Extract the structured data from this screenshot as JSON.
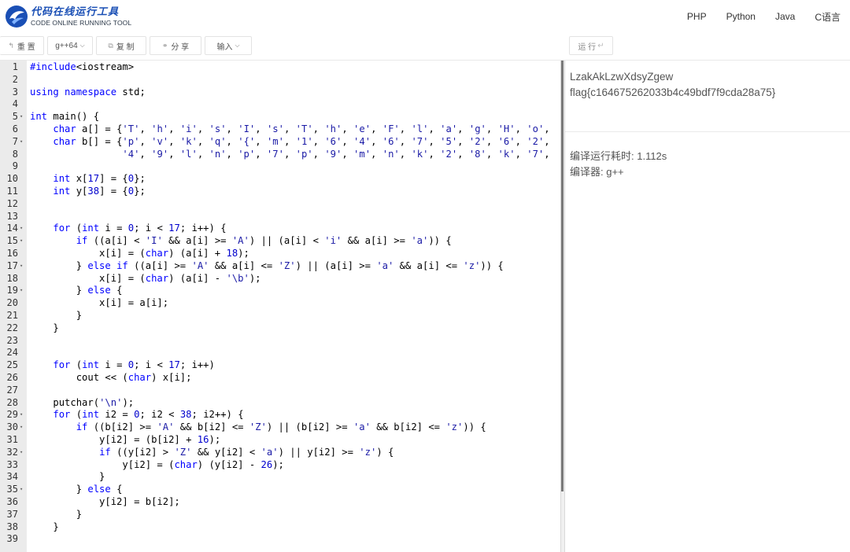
{
  "header": {
    "logo_title": "代码在线运行工具",
    "logo_subtitle": "CODE ONLINE RUNNING TOOL",
    "nav": [
      "PHP",
      "Python",
      "Java",
      "C语言"
    ]
  },
  "toolbar": {
    "reset_label": "重 置",
    "compiler_label": "g++64",
    "copy_label": "复 制",
    "share_label": "分 享",
    "input_label": "输入",
    "run_label": "运 行"
  },
  "editor": {
    "lines": [
      "#include<iostream>",
      "",
      "using namespace std;",
      "",
      "int main() {",
      "    char a[] = {'T', 'h', 'i', 's', 'I', 's', 'T', 'h', 'e', 'F', 'l', 'a', 'g', 'H', 'o',",
      "    char b[] = {'p', 'v', 'k', 'q', '{', 'm', '1', '6', '4', '6', '7', '5', '2', '6', '2',",
      "                '4', '9', 'l', 'n', 'p', '7', 'p', '9', 'm', 'n', 'k', '2', '8', 'k', '7',",
      "",
      "    int x[17] = {0};",
      "    int y[38] = {0};",
      "",
      "",
      "    for (int i = 0; i < 17; i++) {",
      "        if ((a[i] < 'I' && a[i] >= 'A') || (a[i] < 'i' && a[i] >= 'a')) {",
      "            x[i] = (char) (a[i] + 18);",
      "        } else if ((a[i] >= 'A' && a[i] <= 'Z') || (a[i] >= 'a' && a[i] <= 'z')) {",
      "            x[i] = (char) (a[i] - '\\b');",
      "        } else {",
      "            x[i] = a[i];",
      "        }",
      "    }",
      "",
      "",
      "    for (int i = 0; i < 17; i++)",
      "        cout << (char) x[i];",
      "",
      "    putchar('\\n');",
      "    for (int i2 = 0; i2 < 38; i2++) {",
      "        if ((b[i2] >= 'A' && b[i2] <= 'Z') || (b[i2] >= 'a' && b[i2] <= 'z')) {",
      "            y[i2] = (b[i2] + 16);",
      "            if ((y[i2] > 'Z' && y[i2] < 'a') || y[i2] >= 'z') {",
      "                y[i2] = (char) (y[i2] - 26);",
      "            }",
      "        } else {",
      "            y[i2] = b[i2];",
      "        }",
      "    }",
      ""
    ],
    "fold_lines": [
      5,
      7,
      14,
      15,
      17,
      19,
      29,
      30,
      32,
      35
    ]
  },
  "output": {
    "line1": "LzakAkLzwXdsyZgew",
    "line2": "flag{c164675262033b4c49bdf7f9cda28a75}",
    "time_label": "编译运行耗时: 1.112s",
    "compiler_info": "编译器: g++"
  },
  "colors": {
    "keyword": "#0000ff",
    "string": "#1a1aa6",
    "number": "#0000cd",
    "gutter": "#ebebeb",
    "brand": "#1a4fb5"
  }
}
